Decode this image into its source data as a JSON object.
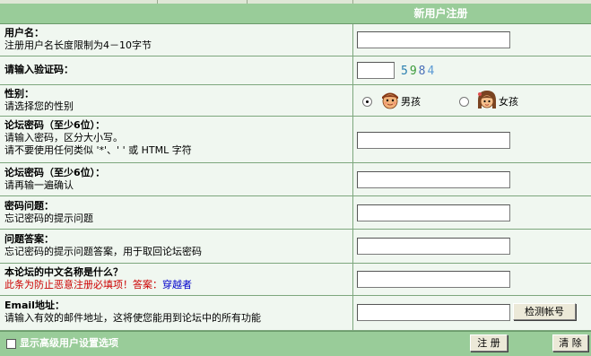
{
  "header": {
    "title": "新用户注册"
  },
  "fields": {
    "username": {
      "label": "用户名：",
      "desc": "注册用户名长度限制为4－10字节"
    },
    "captcha": {
      "label": "请输入验证码：",
      "code": "5984"
    },
    "gender": {
      "label": "性别：",
      "desc": "请选择您的性别",
      "male": "男孩",
      "female": "女孩"
    },
    "password": {
      "label": "论坛密码（至少6位）：",
      "desc1": "请输入密码，区分大小写。",
      "desc2": "请不要使用任何类似 '*'、' ' 或 HTML 字符"
    },
    "confirm": {
      "label": "论坛密码（至少6位）：",
      "desc": "请再输一遍确认"
    },
    "question": {
      "label": "密码问题：",
      "desc": "忘记密码的提示问题"
    },
    "answer": {
      "label": "问题答案：",
      "desc": "忘记密码的提示问题答案，用于取回论坛密码"
    },
    "forum_name": {
      "label": "本论坛的中文名称是什么？",
      "note": "此条为防止恶意注册必填项！答案：",
      "answer": "穿越者"
    },
    "email": {
      "label": "Email地址：",
      "desc": "请输入有效的邮件地址，这将使您能用到论坛中的所有功能",
      "check_button": "检测帐号"
    }
  },
  "footer": {
    "advanced": "显示高级用户设置选项",
    "submit": "注 册",
    "clear": "清 除"
  },
  "colors": {
    "header_bg": "#99cc99",
    "row_bg": "#f0f7f0",
    "border": "#7da77d",
    "captcha": [
      "#2a7fb0",
      "#3a9a3a",
      "#4a6fb8",
      "#5c9ad4"
    ]
  }
}
